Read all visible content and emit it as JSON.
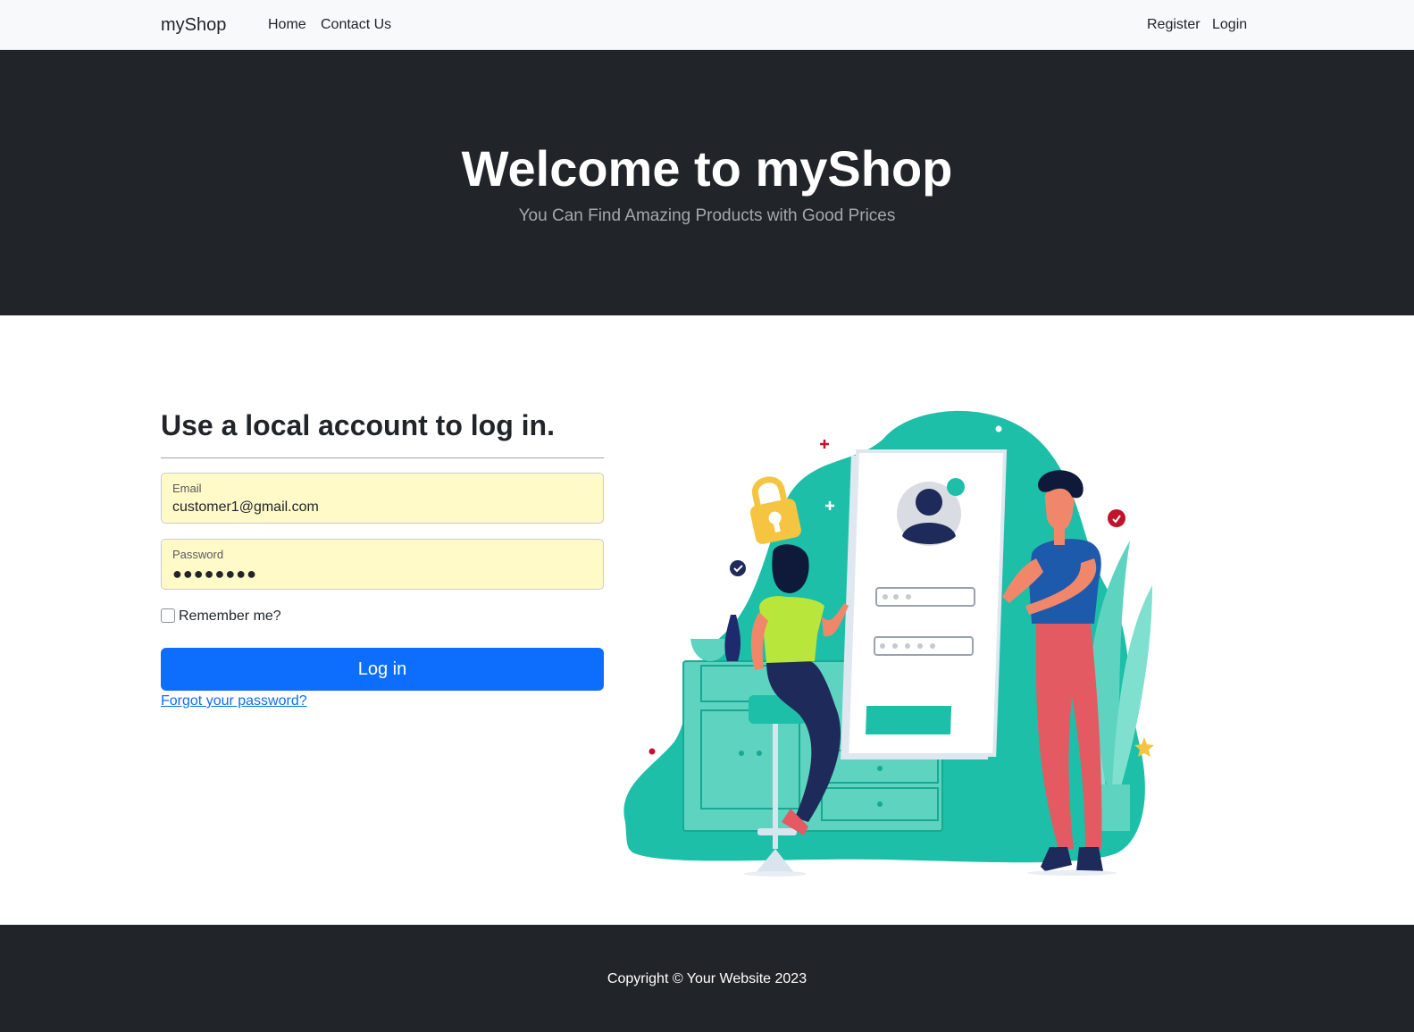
{
  "navbar": {
    "brand": "myShop",
    "links": [
      "Home",
      "Contact Us"
    ],
    "right_links": [
      "Register",
      "Login"
    ]
  },
  "hero": {
    "title": "Welcome to myShop",
    "subtitle": "You Can Find Amazing Products with Good Prices"
  },
  "login": {
    "heading": "Use a local account to log in.",
    "email_label": "Email",
    "email_value": "customer1@gmail.com",
    "password_label": "Password",
    "password_value": "●●●●●●●●",
    "remember_label": "Remember me?",
    "remember_checked": false,
    "submit_label": "Log in",
    "forgot_link": "Forgot your password?"
  },
  "footer": {
    "copyright": "Copyright © Your Website 2023"
  },
  "colors": {
    "navbar_bg": "#f8f9fa",
    "hero_bg": "#212529",
    "primary": "#0d6efd",
    "autofill_bg": "#fffac8",
    "illustration_teal": "#1dbfa8"
  }
}
